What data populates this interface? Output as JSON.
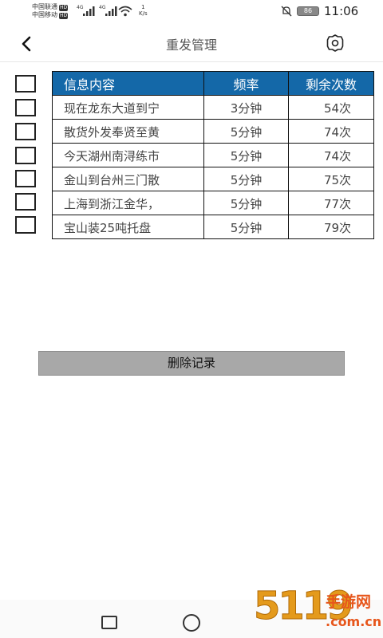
{
  "status_bar": {
    "carrier1": "中国联通",
    "carrier2": "中国移动",
    "hd_badge": "HD",
    "network1": "4G",
    "network2": "4G",
    "speed_value": "1",
    "speed_unit": "K/s",
    "battery": "86",
    "time": "11:06"
  },
  "header": {
    "title": "重发管理",
    "back_icon": "back-arrow-icon",
    "settings_icon": "gear-icon"
  },
  "table": {
    "columns": [
      "信息内容",
      "频率",
      "剩余次数"
    ],
    "rows": [
      {
        "message": "现在龙东大道到宁",
        "frequency": "3分钟",
        "remaining": "54次"
      },
      {
        "message": "散货外发奉贤至黄",
        "frequency": "5分钟",
        "remaining": "74次"
      },
      {
        "message": "今天湖州南浔练市",
        "frequency": "5分钟",
        "remaining": "74次"
      },
      {
        "message": "金山到台州三门散",
        "frequency": "5分钟",
        "remaining": "75次"
      },
      {
        "message": "上海到浙江金华，",
        "frequency": "5分钟",
        "remaining": "77次"
      },
      {
        "message": "宝山装25吨托盘",
        "frequency": "5分钟",
        "remaining": "79次"
      }
    ]
  },
  "actions": {
    "delete_label": "删除记录"
  },
  "watermark": {
    "number": "5119",
    "title": "手游网",
    "domain": ".com.cn"
  },
  "colors": {
    "table_header_bg": "#1468a8",
    "delete_button_bg": "#a8a8a8",
    "watermark_orange": "#e49a1c",
    "watermark_red": "#e7561c"
  }
}
